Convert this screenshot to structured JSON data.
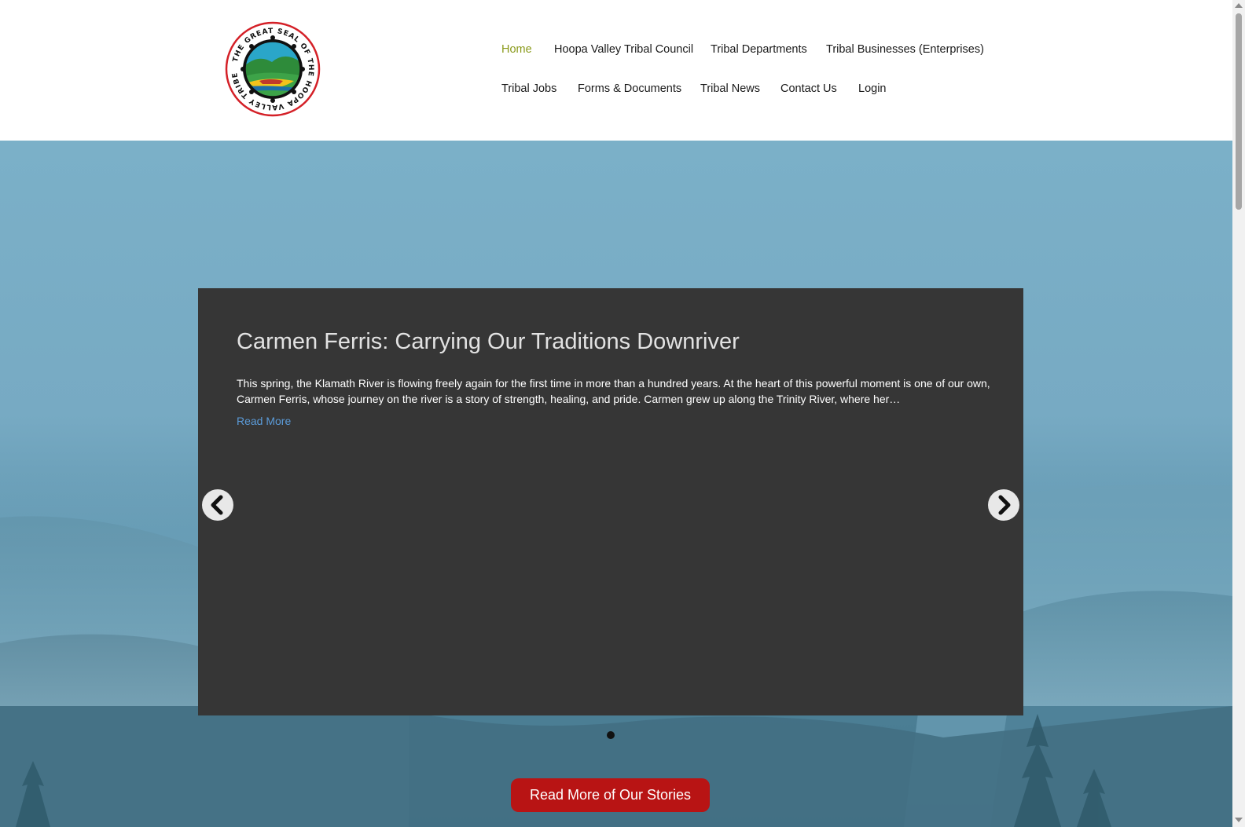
{
  "site": {
    "logo": {
      "alt": "The Great Seal of the Hoopa Valley Tribe",
      "text": "THE GREAT SEAL OF THE HOOPA VALLEY TRIBE",
      "colors": {
        "ring": "#d42027",
        "sky": "#2aa6c9",
        "hills": "#2e8b3a",
        "sand": "#f2c21b"
      }
    }
  },
  "nav": {
    "items": [
      {
        "label": "Home",
        "active": true
      },
      {
        "label": "Hoopa Valley Tribal Council"
      },
      {
        "label": "Tribal Departments"
      },
      {
        "label": "Tribal Businesses (Enterprises)"
      },
      {
        "label": "Tribal Jobs"
      },
      {
        "label": "Forms & Documents"
      },
      {
        "label": "Tribal News"
      },
      {
        "label": "Contact Us"
      },
      {
        "label": "Login"
      }
    ]
  },
  "slider": {
    "slides": [
      {
        "title": "Carmen Ferris: Carrying Our Traditions Downriver",
        "excerpt": "This spring, the Klamath River is flowing freely again for the first time in more than a hundred years. At the heart of this powerful moment is one of our own, Carmen Ferris, whose journey on the river is a story of strength, healing, and pride. Carmen grew up along the Trinity River, where her…",
        "link_label": "Read More"
      }
    ],
    "prev_icon": "chevron-left-icon",
    "next_icon": "chevron-right-icon",
    "dot_count": 1
  },
  "cta": {
    "label": "Read More of Our Stories"
  },
  "colors": {
    "nav_active": "#8a9a1b",
    "slider_bg": "#363636",
    "link": "#5b9bd8",
    "cta_bg": "#b81414"
  }
}
